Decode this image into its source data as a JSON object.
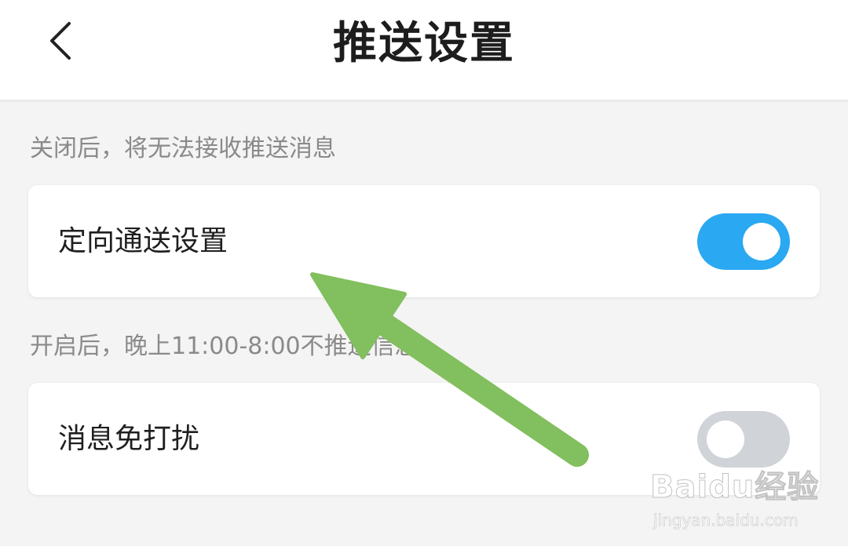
{
  "header": {
    "title": "推送设置",
    "back_icon": "chevron-left-icon"
  },
  "sections": [
    {
      "hint": "关闭后，将无法接收推送消息",
      "label": "定向通送设置",
      "toggle_state": "on",
      "toggle_color": "#2aa8f2"
    },
    {
      "hint": "开启后，晚上11:00-8:00不推送信息",
      "label": "消息免打扰",
      "toggle_state": "off",
      "toggle_color": "#d0d3d8"
    }
  ],
  "overlay": {
    "arrow_color": "#82bf5e",
    "arrow_icon": "annotation-arrow-icon"
  },
  "watermark": {
    "logo": "Baidu经验",
    "url": "jingyan.baidu.com"
  }
}
